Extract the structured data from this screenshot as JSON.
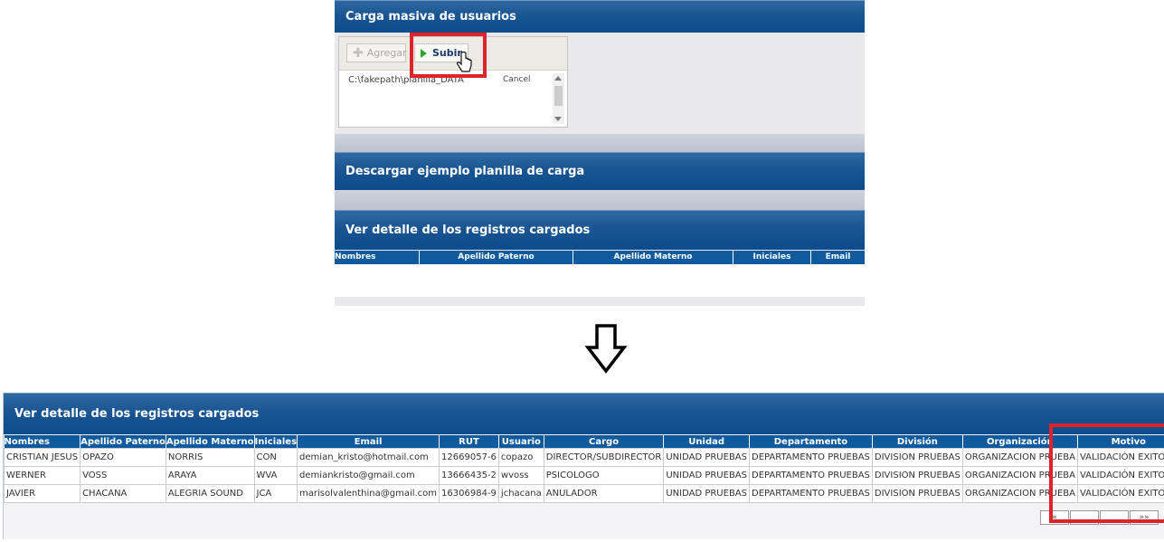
{
  "top": {
    "upload_section_title": "Carga masiva de usuarios",
    "agregar_label": "Agregar",
    "subir_label": "Subir",
    "file_path": "C:\\fakepath\\planilla_DATA",
    "cancel_label": "Cancel",
    "download_section_title": "Descargar ejemplo planilla de carga",
    "detail_section_title": "Ver detalle de los registros cargados",
    "columns": [
      "Nombres",
      "Apellido Paterno",
      "Apellido Materno",
      "Iniciales",
      "Email"
    ]
  },
  "bottom": {
    "detail_section_title": "Ver detalle de los registros cargados",
    "columns": [
      "Nombres",
      "Apellido Paterno",
      "Apellido Materno",
      "Iniciales",
      "Email",
      "RUT",
      "Usuario",
      "Cargo",
      "Unidad",
      "Departamento",
      "División",
      "Organización",
      "Motivo"
    ],
    "rows": [
      [
        "CRISTIAN JESUS",
        "OPAZO",
        "NORRIS",
        "CON",
        "demian_kristo@hotmail.com",
        "12669057-6",
        "copazo",
        "DIRECTOR/SUBDIRECTOR",
        "UNIDAD PRUEBAS",
        "DEPARTAMENTO PRUEBAS",
        "DIVISION PRUEBAS",
        "ORGANIZACION PRUEBA",
        "VALIDACIÓN EXITOSA"
      ],
      [
        "WERNER",
        "VOSS",
        "ARAYA",
        "WVA",
        "demiankristo@gmail.com",
        "13666435-2",
        "wvoss",
        "PSICOLOGO",
        "UNIDAD PRUEBAS",
        "DEPARTAMENTO PRUEBAS",
        "DIVISION PRUEBAS",
        "ORGANIZACION PRUEBA",
        "VALIDACIÓN EXITOSA"
      ],
      [
        "JAVIER",
        "CHACANA",
        "ALEGRIA SOUND",
        "JCA",
        "marisolvalenthina@gmail.com",
        "16306984-9",
        "jchacana",
        "ANULADOR",
        "UNIDAD PRUEBAS",
        "DEPARTAMENTO PRUEBAS",
        "DIVISION PRUEBAS",
        "ORGANIZACION PRUEBA",
        "VALIDACIÓN EXITOSA"
      ]
    ],
    "pager": [
      "«",
      "",
      "",
      "»»"
    ]
  },
  "colors": {
    "header_blue": "#0e5a9d",
    "highlight_red": "#e0222a"
  },
  "icons": {
    "agregar": "plus-icon",
    "subir": "play-icon",
    "cursor": "hand-cursor-icon",
    "transition": "down-arrow-icon"
  }
}
